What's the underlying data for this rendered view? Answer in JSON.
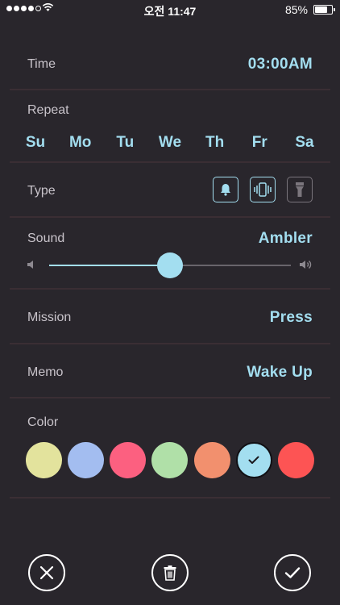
{
  "status_bar": {
    "time": "오전 11:47",
    "battery": "85%",
    "battery_level": 0.85,
    "signal_bars": 4
  },
  "form": {
    "time": {
      "label": "Time",
      "value": "03:00AM"
    },
    "repeat": {
      "label": "Repeat",
      "days": [
        "Su",
        "Mo",
        "Tu",
        "We",
        "Th",
        "Fr",
        "Sa"
      ]
    },
    "type": {
      "label": "Type",
      "options": [
        {
          "icon": "bell-icon",
          "active": true
        },
        {
          "icon": "vibrate-icon",
          "active": true
        },
        {
          "icon": "flashlight-icon",
          "active": false
        }
      ]
    },
    "sound": {
      "label": "Sound",
      "value": "Ambler",
      "volume": 0.5
    },
    "mission": {
      "label": "Mission",
      "value": "Press"
    },
    "memo": {
      "label": "Memo",
      "value": "Wake Up"
    },
    "color": {
      "label": "Color",
      "swatches": [
        "#e3e39d",
        "#a3bdf0",
        "#fc6080",
        "#b0e0a8",
        "#f2906e",
        "#a3def0",
        "#fd5454"
      ],
      "selected_index": 5
    }
  },
  "theme": {
    "accent": "#a3def0",
    "background": "#29262c"
  },
  "actions": [
    "close-icon",
    "trash-icon",
    "check-icon"
  ]
}
